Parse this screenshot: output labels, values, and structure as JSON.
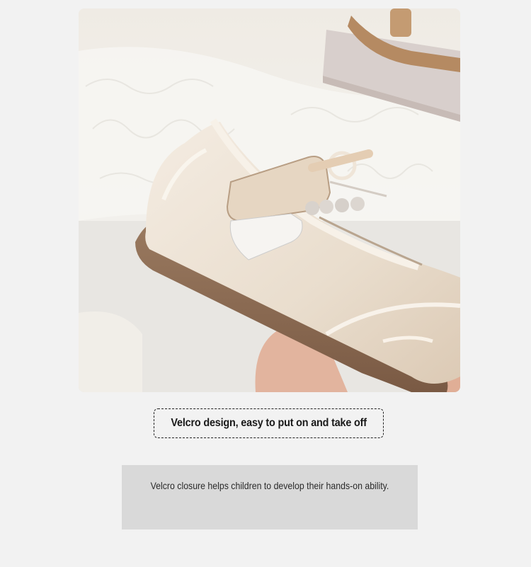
{
  "product_image": {
    "alt": "product-photo",
    "colors": {
      "shoe": "#ede3d6",
      "sole": "#8a6a52",
      "background": "#ece8e1",
      "pearl": "#d8d2cc"
    }
  },
  "caption": {
    "text": "Velcro design, easy to put on and take off"
  },
  "description": {
    "text": "Velcro closure helps children to develop their hands-on ability."
  }
}
